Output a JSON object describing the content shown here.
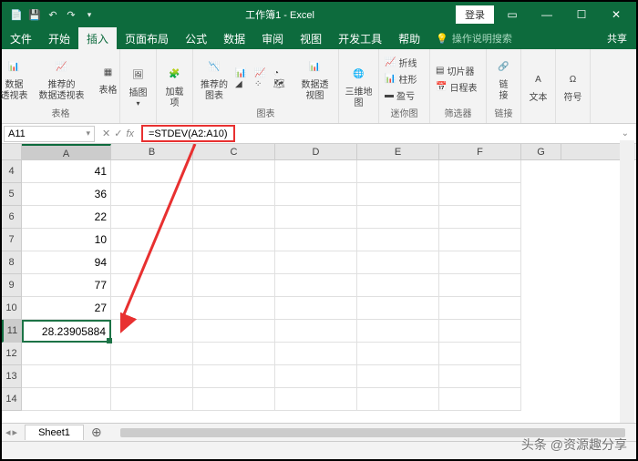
{
  "title": "工作簿1 - Excel",
  "login": "登录",
  "menus": [
    "文件",
    "开始",
    "插入",
    "页面布局",
    "公式",
    "数据",
    "审阅",
    "视图",
    "开发工具",
    "帮助"
  ],
  "tellMe": "操作说明搜索",
  "share": "共享",
  "ribbon": {
    "tables": {
      "pivot": "数据\n透视表",
      "recPivot": "推荐的\n数据透视表",
      "table": "表格",
      "label": "表格"
    },
    "illus": {
      "pictures": "插图",
      "dd": "▾"
    },
    "addins": {
      "btn": "加载\n项"
    },
    "charts": {
      "recChart": "推荐的\n图表",
      "pivotChart": "数据透视图",
      "label": "图表"
    },
    "map3d": {
      "btn": "三维地\n图"
    },
    "sparklines": {
      "line": "折线",
      "col": "柱形",
      "winloss": "盈亏",
      "label": "迷你图"
    },
    "filters": {
      "slicer": "切片器",
      "timeline": "日程表",
      "label": "筛选器"
    },
    "links": {
      "btn": "链\n接",
      "label": "链接"
    },
    "text": {
      "btn": "文本"
    },
    "symbols": {
      "btn": "符号"
    }
  },
  "namebox": "A11",
  "fx": "fx",
  "formula": "=STDEV(A2:A10)",
  "colHeaders": [
    "A",
    "B",
    "C",
    "D",
    "E",
    "F",
    "G"
  ],
  "rowHeaders": [
    "4",
    "5",
    "6",
    "7",
    "8",
    "9",
    "10",
    "11",
    "12",
    "13",
    "14"
  ],
  "cells": {
    "r4": "41",
    "r5": "36",
    "r6": "22",
    "r7": "10",
    "r8": "94",
    "r9": "77",
    "r10": "27",
    "r11": "28.23905884"
  },
  "sheetTab": "Sheet1",
  "watermark": "头条 @资源趣分享"
}
